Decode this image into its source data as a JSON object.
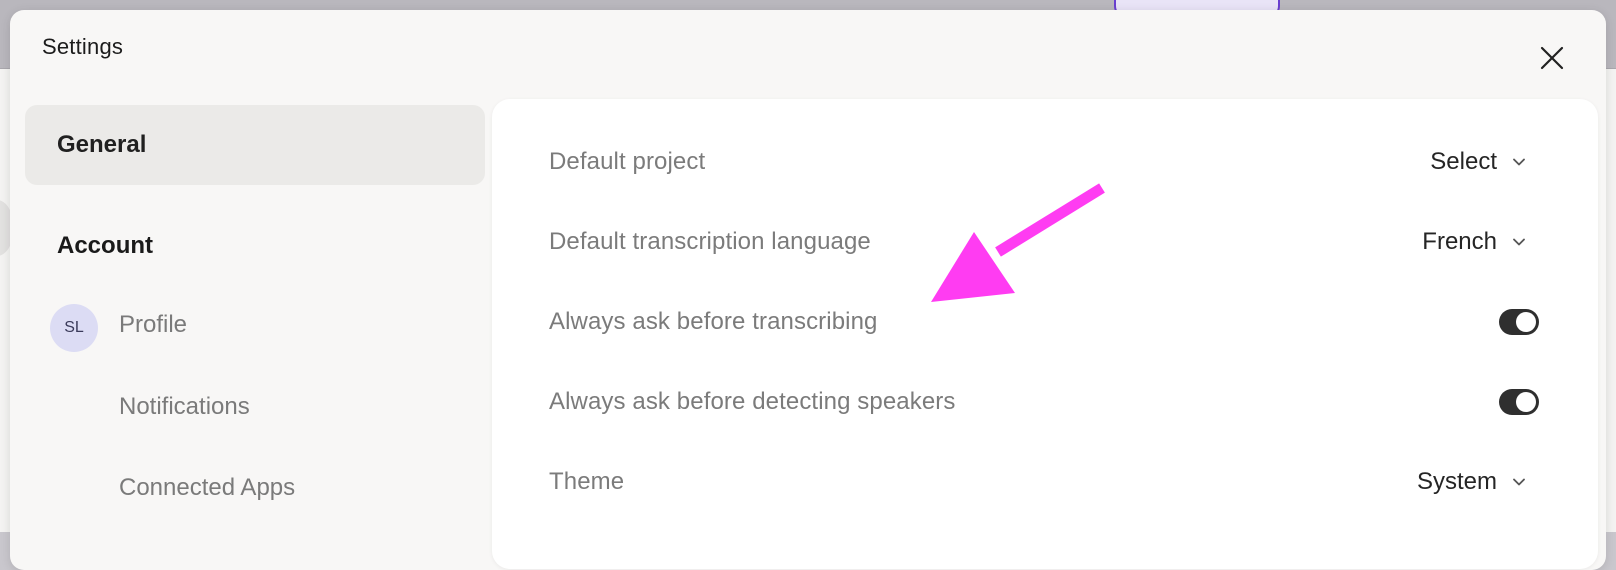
{
  "modal": {
    "title": "Settings"
  },
  "sidebar": {
    "general_label": "General",
    "account_heading": "Account",
    "avatar_initials": "SL",
    "items": [
      {
        "label": "Profile"
      },
      {
        "label": "Notifications"
      },
      {
        "label": "Connected Apps"
      }
    ]
  },
  "settings": {
    "rows": [
      {
        "label": "Default project",
        "control": "dropdown",
        "value": "Select"
      },
      {
        "label": "Default transcription language",
        "control": "dropdown",
        "value": "French"
      },
      {
        "label": "Always ask before transcribing",
        "control": "toggle",
        "on": true
      },
      {
        "label": "Always ask before detecting speakers",
        "control": "toggle",
        "on": true
      },
      {
        "label": "Theme",
        "control": "dropdown",
        "value": "System"
      }
    ]
  },
  "annotation": {
    "color": "#ff3cf2"
  },
  "colors": {
    "accent_toggle": "#2f2f2f",
    "avatar_bg": "#dcdcf4"
  }
}
